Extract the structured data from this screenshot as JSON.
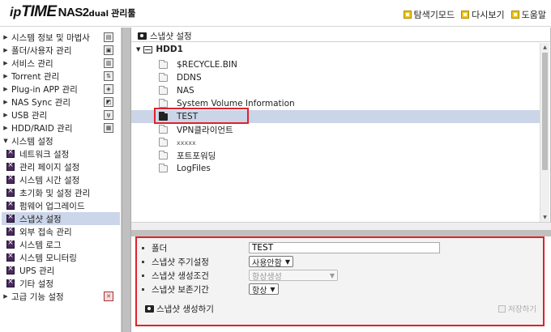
{
  "header": {
    "logo_ip": "ip",
    "logo_time": "TIME",
    "logo_model": "NAS2",
    "logo_suffix": "dual",
    "logo_manager": "관리툴",
    "links": [
      {
        "label": "탐색기모드",
        "icon": "explorer-icon"
      },
      {
        "label": "다시보기",
        "icon": "refresh-icon"
      },
      {
        "label": "도움말",
        "icon": "help-icon"
      }
    ]
  },
  "sidebar": {
    "top_items": [
      {
        "label": "시스템 정보 및 마법사",
        "expanded": false
      },
      {
        "label": "폴더/사용자 관리",
        "expanded": false
      },
      {
        "label": "서비스 관리",
        "expanded": false
      },
      {
        "label": "Torrent 관리",
        "expanded": false
      },
      {
        "label": "Plug-in APP 관리",
        "expanded": false
      },
      {
        "label": "NAS Sync 관리",
        "expanded": false
      },
      {
        "label": "USB 관리",
        "expanded": false
      },
      {
        "label": "HDD/RAID 관리",
        "expanded": false
      },
      {
        "label": "시스템 설정",
        "expanded": true
      }
    ],
    "sub_items": [
      "네트워크 설정",
      "관리 페이지 설정",
      "시스템 시간 설정",
      "초기화 및 설정 관리",
      "펌웨어 업그레이드",
      "스냅샷 설정",
      "외부 접속 관리",
      "시스템 로그",
      "시스템 모니터링",
      "UPS 관리",
      "기타 설정"
    ],
    "selected_sub": "스냅샷 설정",
    "bottom_item": {
      "label": "고급 기능 설정",
      "expanded": false
    }
  },
  "explorer": {
    "title": "스냅샷 설정",
    "root": "HDD1",
    "folders": [
      "$RECYCLE.BIN",
      "DDNS",
      "NAS",
      "System Volume Information",
      "TEST",
      "VPN클라이언트",
      "xxxxx",
      "포트포워딩",
      "LogFiles"
    ],
    "selected_folder": "TEST"
  },
  "props": {
    "folder_label": "폴더",
    "folder_value": "TEST",
    "cycle_label": "스냅샷 주기설정",
    "cycle_value": "사용안함",
    "cond_label": "스냅샷 생성조건",
    "cond_value": "항상생성",
    "keep_label": "스냅샷 보존기간",
    "keep_value": "항상",
    "create_label": "스냅샷 생성하기",
    "save_label": "저장하기"
  }
}
